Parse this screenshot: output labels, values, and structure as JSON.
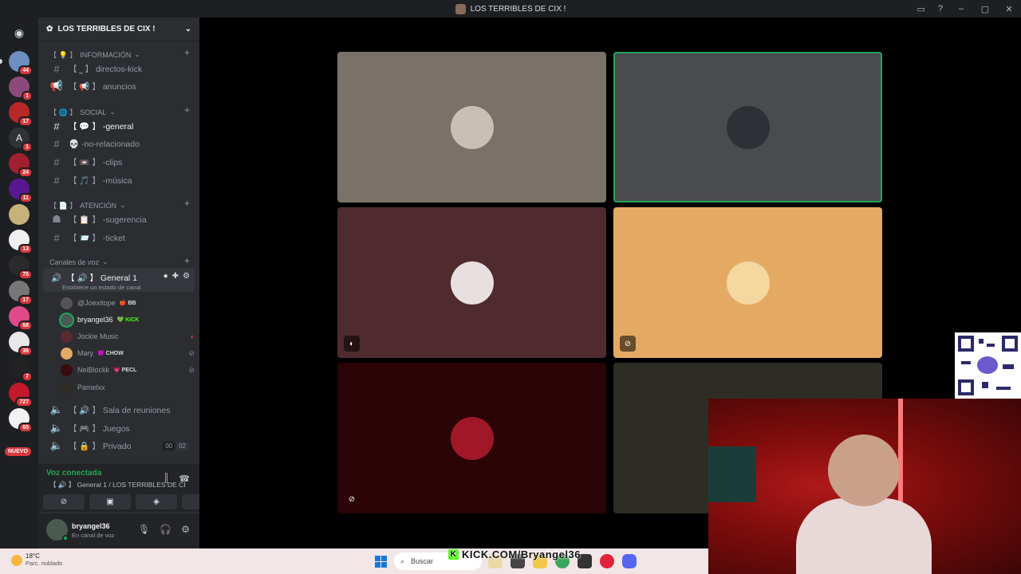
{
  "window": {
    "title": "LOS TERRIBLES DE CIX !"
  },
  "guilds": {
    "badges": [
      "44",
      "1",
      "17",
      "1",
      "24",
      "11",
      "13",
      "75",
      "17",
      "68",
      "36",
      "7",
      "727",
      "65"
    ],
    "first_letter": "A",
    "new_label": "NUEVO"
  },
  "server": {
    "name": "LOS TERRIBLES DE CIX !"
  },
  "categories": {
    "info": "INFORMACIÓN",
    "social": "SOCIAL",
    "attention": "ATENCIÓN",
    "voice": "Canales de voz"
  },
  "channels": {
    "directos": "【 ⎵ 】 directos-kick",
    "anuncios": "【 📢 】 anuncios",
    "general": "【 💬 】 -general",
    "norelacionado": "💀 -no-relacionado",
    "clips": "【 📼 】 -clips",
    "musica": "【 🎵 】 -música",
    "sugerencia": "【 📋 】 -sugerencia",
    "ticket": "【 📨 】 -ticket"
  },
  "voice_channel": {
    "name": "【 🔊 】 General 1",
    "status": "Establece un estado de canal"
  },
  "voice_users": [
    {
      "name": "@Joexitope",
      "tag": "🍎 BB"
    },
    {
      "name": "bryangel36",
      "tag": "💚 KICK"
    },
    {
      "name": "Jockie Music",
      "tag": ""
    },
    {
      "name": "Mary",
      "tag": "😈 CHOW"
    },
    {
      "name": "NeiBlockk",
      "tag": "💗 PECL"
    },
    {
      "name": "Pamelxx",
      "tag": ""
    }
  ],
  "other_voice": {
    "sala": "【 🔊 】 Sala de reuniones",
    "juegos": "【 🎮 】 Juegos",
    "privado": "【 🔒 】 Privado",
    "privado_count_a": "00",
    "privado_count_b": "02"
  },
  "voice_panel": {
    "connected": "Voz conectada",
    "location": "【 🔊 】 General 1 / LOS TERRIBLES DE CIX !"
  },
  "user": {
    "name": "bryangel36",
    "status": "En canal de voz"
  },
  "taskbar": {
    "temp": "18°C",
    "weather": "Parc. nublado",
    "search": "Buscar",
    "overlay": "KICK.COM/Bryangel36"
  },
  "colors": {
    "tile1": "#7a7269",
    "tile2": "#4a4b4f",
    "tile3": "#4f2a2f",
    "tile4": "#e4aa64",
    "tile5": "#2a0406",
    "tile6": "#2d2d25",
    "speaking": "#23a55a"
  }
}
